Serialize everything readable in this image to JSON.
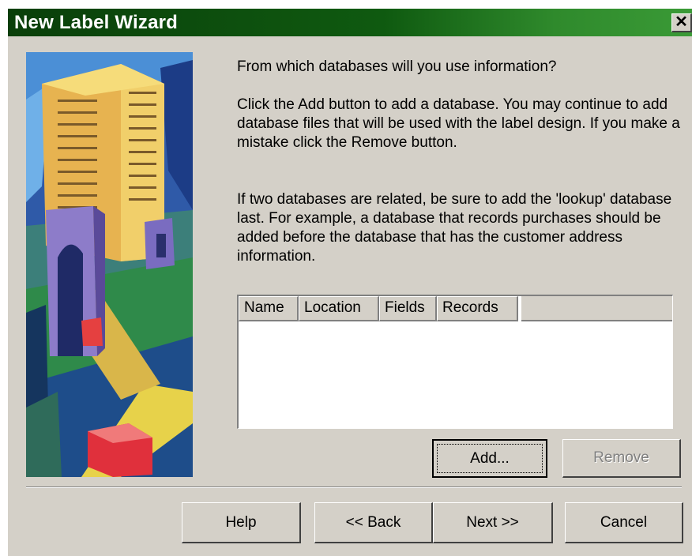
{
  "window": {
    "title": "New Label Wizard",
    "close_glyph": "✕"
  },
  "intro": {
    "question": "From which databases will you use information?",
    "instructions": "Click the Add button to add a database.  You may continue to add database files that will be used with the label design.  If you make a mistake click the Remove button.",
    "lookup_note": "If two databases are related, be sure to add the 'lookup' database last. For example, a database that records purchases should be added before the database that has the customer address information."
  },
  "list": {
    "columns": [
      "Name",
      "Location",
      "Fields",
      "Records"
    ],
    "rows": []
  },
  "buttons": {
    "add": "Add...",
    "remove": "Remove",
    "help": "Help",
    "back": "<< Back",
    "next": "Next >>",
    "cancel": "Cancel"
  },
  "colors": {
    "titlebar_start": "#0a3f0a",
    "titlebar_end": "#3a9a36",
    "dialog_face": "#d4d0c8"
  },
  "icons": {
    "close": "close-icon",
    "picture": "wizard-illustration"
  }
}
